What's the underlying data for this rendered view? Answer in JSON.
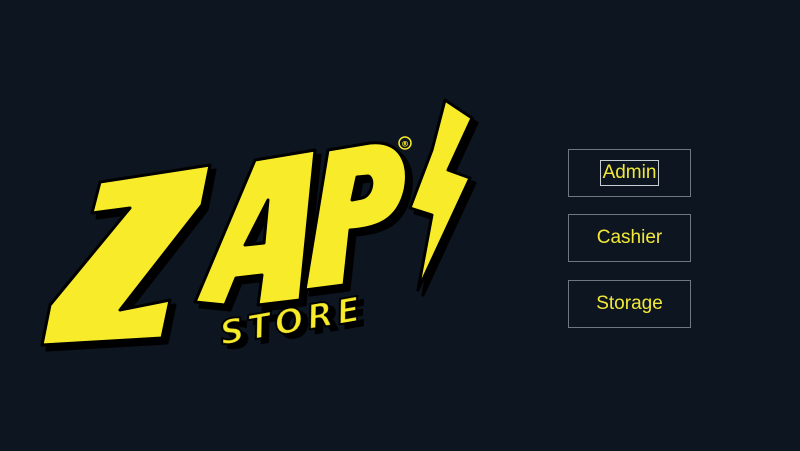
{
  "logo": {
    "word": "ZAP",
    "sub": "STORE",
    "registered": "®",
    "yellow": "#f8ec2a",
    "shadow": "#000000"
  },
  "colors": {
    "background": "#0d1520",
    "button_text": "#f2e83a",
    "button_border": "#6f7780"
  },
  "menu": {
    "admin_label": "Admin",
    "cashier_label": "Cashier",
    "storage_label": "Storage",
    "focused": "Admin"
  }
}
